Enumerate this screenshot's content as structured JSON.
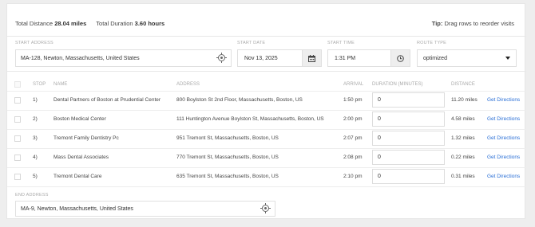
{
  "summary": {
    "distance_label": "Total Distance",
    "distance_value": "28.04 miles",
    "duration_label": "Total Duration",
    "duration_value": "3.60 hours",
    "tip_label": "Tip:",
    "tip_text": "Drag rows to reorder visits"
  },
  "form": {
    "start_address_label": "START ADDRESS",
    "start_address_value": "MA-128, Newton, Massachusetts, United States",
    "start_date_label": "START DATE",
    "start_date_value": "Nov 13, 2025",
    "start_time_label": "START TIME",
    "start_time_value": "1:31 PM",
    "route_type_label": "ROUTE TYPE",
    "route_type_value": "optimized",
    "end_address_label": "END ADDRESS",
    "end_address_value": "MA-9, Newton, Massachusetts, United States"
  },
  "table": {
    "headers": {
      "stop": "STOP",
      "name": "NAME",
      "address": "ADDRESS",
      "arrival": "ARRIVAL",
      "duration": "DURATION (MINUTES)",
      "distance": "DISTANCE"
    },
    "rows": [
      {
        "stop": "1)",
        "name": "Dental Partners of Boston at Prudential Center",
        "address": "800 Boylston St 2nd Floor, Massachusetts, Boston, US",
        "arrival": "1:50 pm",
        "duration": "0",
        "distance": "11.20 miles",
        "link": "Get Directions"
      },
      {
        "stop": "2)",
        "name": "Boston Medical Center",
        "address": "111 Huntington Avenue Boylston St, Massachusetts, Boston, US",
        "arrival": "2:00 pm",
        "duration": "0",
        "distance": "4.58 miles",
        "link": "Get Directions"
      },
      {
        "stop": "3)",
        "name": "Tremont Family Dentistry Pc",
        "address": "951 Tremont St, Massachusetts, Boston, US",
        "arrival": "2:07 pm",
        "duration": "0",
        "distance": "1.32 miles",
        "link": "Get Directions"
      },
      {
        "stop": "4)",
        "name": "Mass Dental Associates",
        "address": "770 Tremont St, Massachusetts, Boston, US",
        "arrival": "2:08 pm",
        "duration": "0",
        "distance": "0.22 miles",
        "link": "Get Directions"
      },
      {
        "stop": "5)",
        "name": "Tremont Dental Care",
        "address": "635 Tremont St, Massachusetts, Boston, US",
        "arrival": "2:10 pm",
        "duration": "0",
        "distance": "0.31 miles",
        "link": "Get Directions"
      }
    ]
  },
  "icons": {
    "location": "crosshair-target-icon",
    "calendar": "calendar-icon",
    "clock": "clock-icon",
    "dropdown": "caret-down-icon"
  },
  "colors": {
    "link": "#2a6fd6",
    "label": "#aaaaaa",
    "background": "#eeeeee"
  }
}
